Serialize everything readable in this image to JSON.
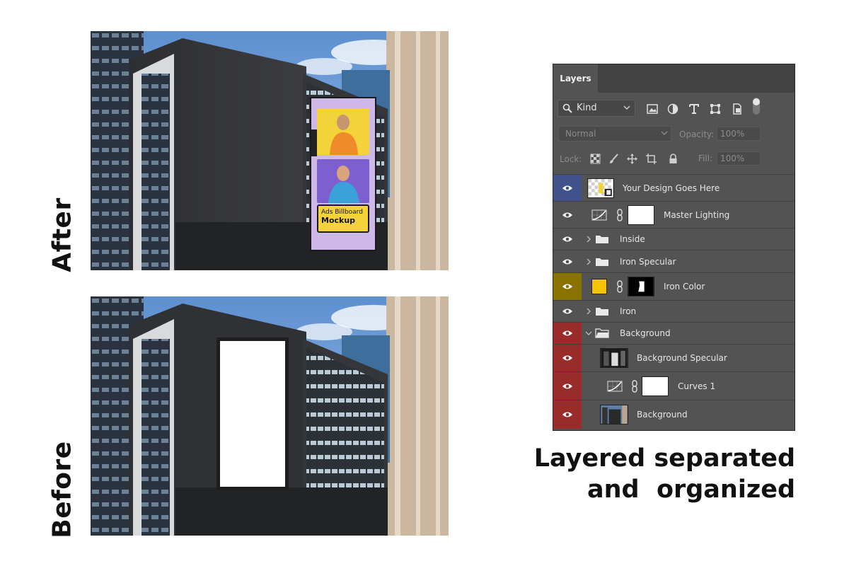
{
  "labels": {
    "after": "After",
    "before": "Before"
  },
  "billboard": {
    "line1": "Ads Billboard",
    "line2": "Mockup"
  },
  "layers_panel": {
    "tab": "Layers",
    "filter_kind": "Kind",
    "blend_mode": "Normal",
    "opacity_label": "Opacity:",
    "opacity_value": "100%",
    "lock_label": "Lock:",
    "fill_label": "Fill:",
    "fill_value": "100%",
    "layers": [
      {
        "name": "Your Design Goes Here",
        "color": "#41518b"
      },
      {
        "name": "Master Lighting",
        "color": "none"
      },
      {
        "name": "Inside",
        "color": "none",
        "type": "group"
      },
      {
        "name": "Iron Specular",
        "color": "none",
        "type": "group"
      },
      {
        "name": "Iron Color",
        "color": "#8a7200"
      },
      {
        "name": "Iron",
        "color": "none",
        "type": "group"
      },
      {
        "name": "Background",
        "color": "#9a2b2b",
        "type": "group-open"
      },
      {
        "name": "Background Specular",
        "color": "#9a2b2b"
      },
      {
        "name": "Curves 1",
        "color": "#9a2b2b"
      },
      {
        "name": "Background",
        "color": "#9a2b2b"
      }
    ]
  },
  "tagline": {
    "line1": "Layered separated",
    "line2": "and  organized"
  }
}
